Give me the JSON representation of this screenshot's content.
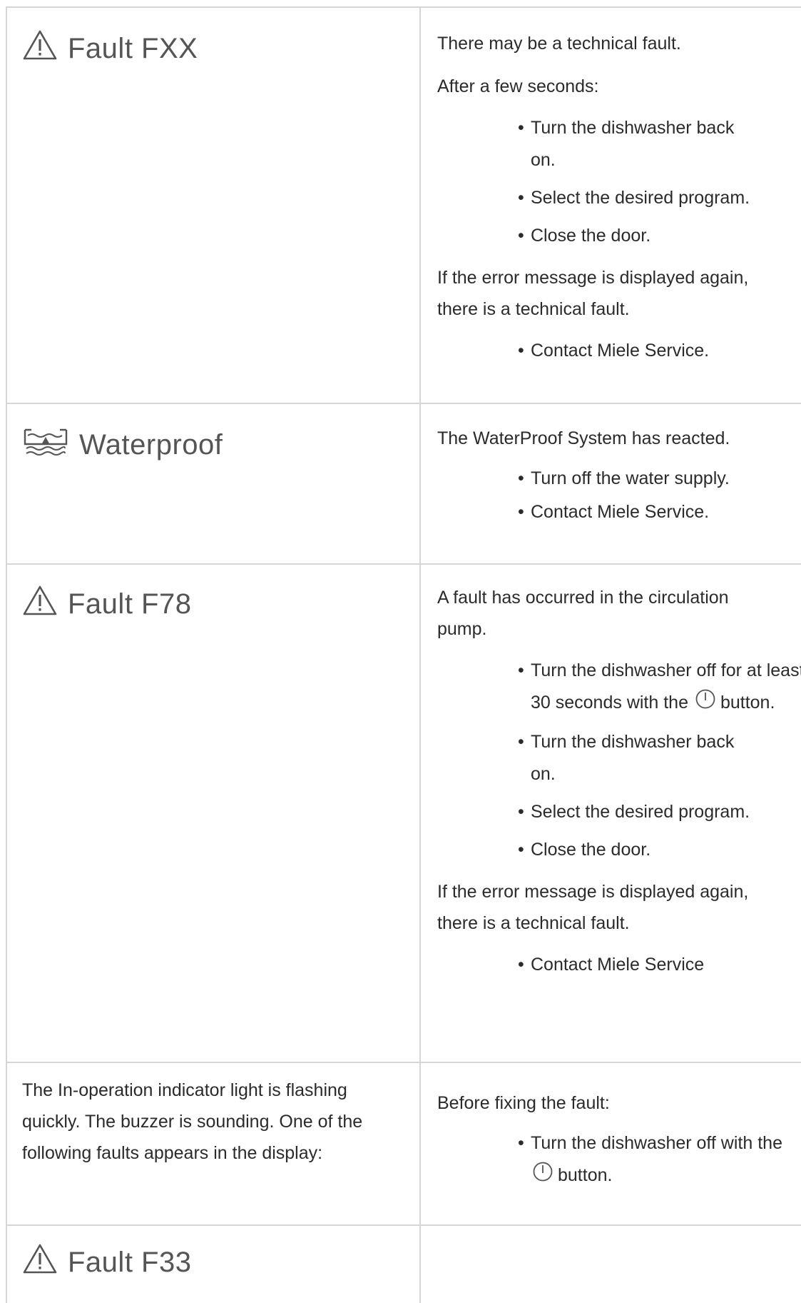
{
  "rows": [
    {
      "label": "Fault FXX",
      "label_icon": "warning-triangle-icon",
      "intro": [
        "There may be a technical fault.",
        "After a few seconds:"
      ],
      "steps": [
        "Turn the dishwasher back on.",
        "Select the desired program.",
        "Close the door."
      ],
      "outro": "If the error message is displayed again, there is a technical fault.",
      "final_step": "Contact Miele Service."
    },
    {
      "label": "Waterproof",
      "label_icon": "waterproof-icon",
      "intro": "The WaterProof System has reacted.",
      "steps": [
        "Turn off the water supply.",
        "Contact Miele Service."
      ]
    },
    {
      "label": "Fault F78",
      "label_icon": "warning-triangle-icon",
      "intro": "A fault has occurred in the circulation pump.",
      "step1_before": "Turn the dishwasher off for at least 30 seconds with the",
      "step1_after": "button.",
      "power_icon": "power-button-icon",
      "steps": [
        "Turn the dishwasher back on.",
        "Select the desired program.",
        "Close the door."
      ],
      "outro": "If the error message is displayed again, there is a technical fault.",
      "final_step": "Contact Miele Service"
    },
    {
      "left_text": "The In-operation indicator light is flashing quickly. The buzzer is sounding. One of the following faults appears in the display:",
      "intro": "Before fixing the fault:",
      "step_before": "Turn the dishwasher off with the",
      "step_after": "button."
    },
    {
      "label": "Fault F33",
      "label_icon": "warning-triangle-icon"
    }
  ]
}
